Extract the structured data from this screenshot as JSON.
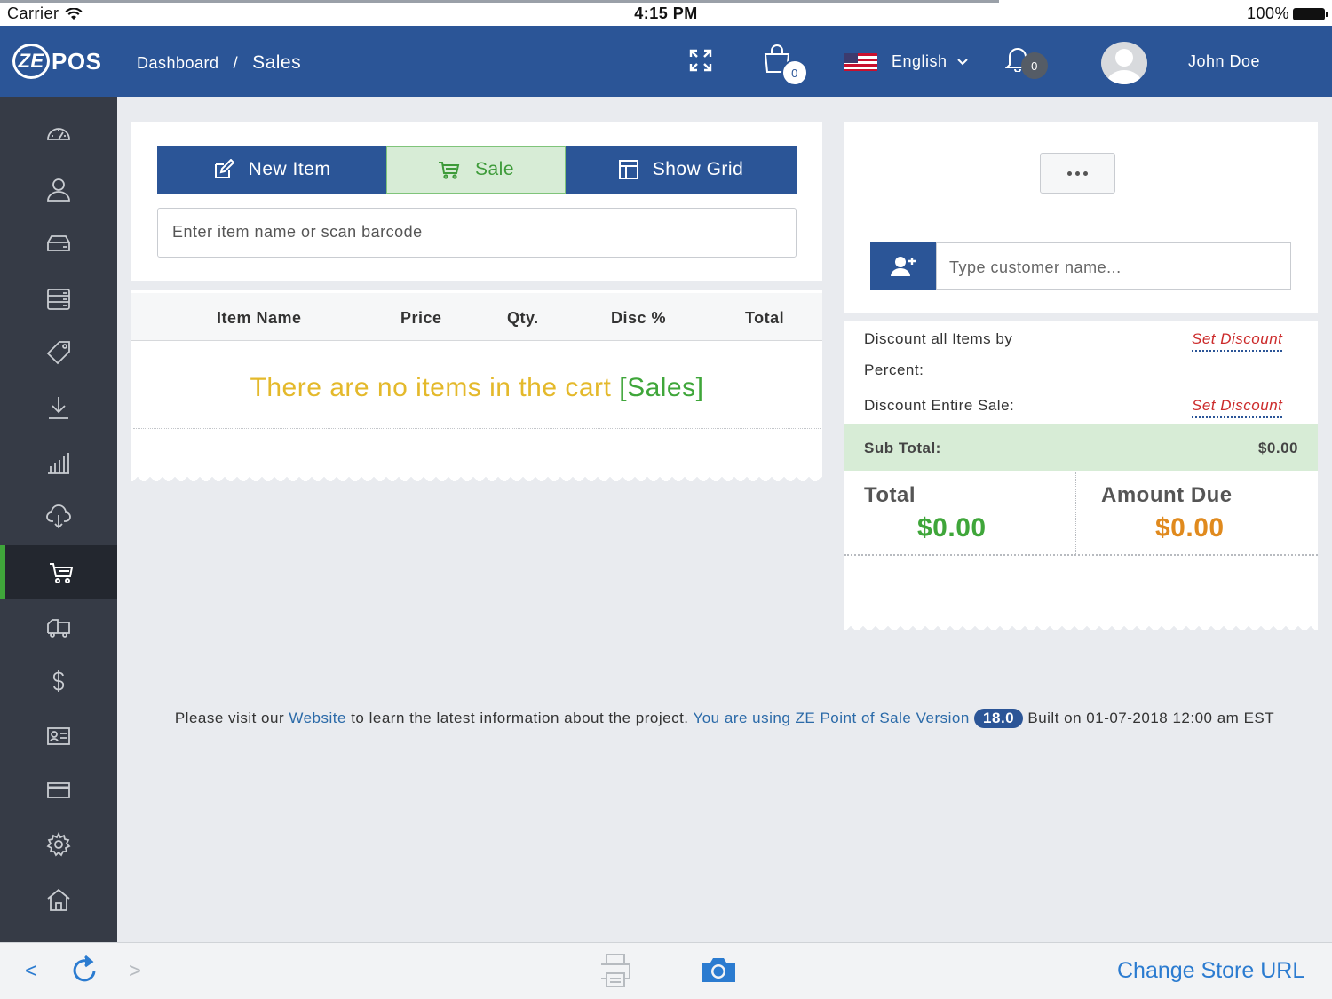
{
  "status_bar": {
    "carrier": "Carrier",
    "time": "4:15 PM",
    "battery": "100%"
  },
  "header": {
    "logo_text": "POS",
    "logo_mark": "ZE",
    "breadcrumb": {
      "parent": "Dashboard",
      "separator": "/",
      "current": "Sales"
    },
    "cart_count": "0",
    "language": "English",
    "notification_count": "0",
    "user_name": "John Doe"
  },
  "sidebar": {
    "items": [
      {
        "icon": "dashboard-gauge-icon"
      },
      {
        "icon": "customers-icon"
      },
      {
        "icon": "items-icon"
      },
      {
        "icon": "item-kits-icon"
      },
      {
        "icon": "price-tags-icon"
      },
      {
        "icon": "receivings-icon"
      },
      {
        "icon": "reports-chart-icon"
      },
      {
        "icon": "cloud-download-icon"
      },
      {
        "icon": "sales-cart-icon",
        "active": true
      },
      {
        "icon": "suppliers-truck-icon"
      },
      {
        "icon": "expenses-dollar-icon"
      },
      {
        "icon": "employees-card-icon"
      },
      {
        "icon": "payment-card-icon"
      },
      {
        "icon": "settings-gear-icon"
      },
      {
        "icon": "locations-home-icon"
      }
    ]
  },
  "register": {
    "tabs": {
      "new_item": "New Item",
      "sale": "Sale",
      "show_grid": "Show Grid"
    },
    "search_placeholder": "Enter item name or scan barcode",
    "columns": {
      "item_name": "Item Name",
      "price": "Price",
      "qty": "Qty.",
      "disc": "Disc %",
      "total": "Total"
    },
    "empty_message": "There are no items in the cart",
    "empty_mode": "[Sales]"
  },
  "summary": {
    "customer_placeholder": "Type customer name...",
    "discount_percent_label_1": "Discount all Items by",
    "discount_percent_label_2": "Percent:",
    "discount_entire_label": "Discount Entire Sale:",
    "set_discount": "Set Discount",
    "sub_total_label": "Sub Total:",
    "sub_total_value": "$0.00",
    "total_label": "Total",
    "total_value": "$0.00",
    "amount_due_label": "Amount Due",
    "amount_due_value": "$0.00"
  },
  "footer": {
    "prefix": "Please visit our",
    "website": "Website",
    "middle": "to learn the latest information about the project.",
    "version_text": "You are using ZE Point of Sale Version",
    "version": "18.0",
    "built": "Built on 01-07-2018 12:00 am EST"
  },
  "browser_bar": {
    "back": "<",
    "forward": ">",
    "change_store_url": "Change Store URL"
  },
  "colors": {
    "primary": "#2b5597",
    "success": "#3fa63a",
    "warning": "#e4b92b",
    "amount_due": "#e08a1e",
    "danger": "#cc2b2b"
  }
}
